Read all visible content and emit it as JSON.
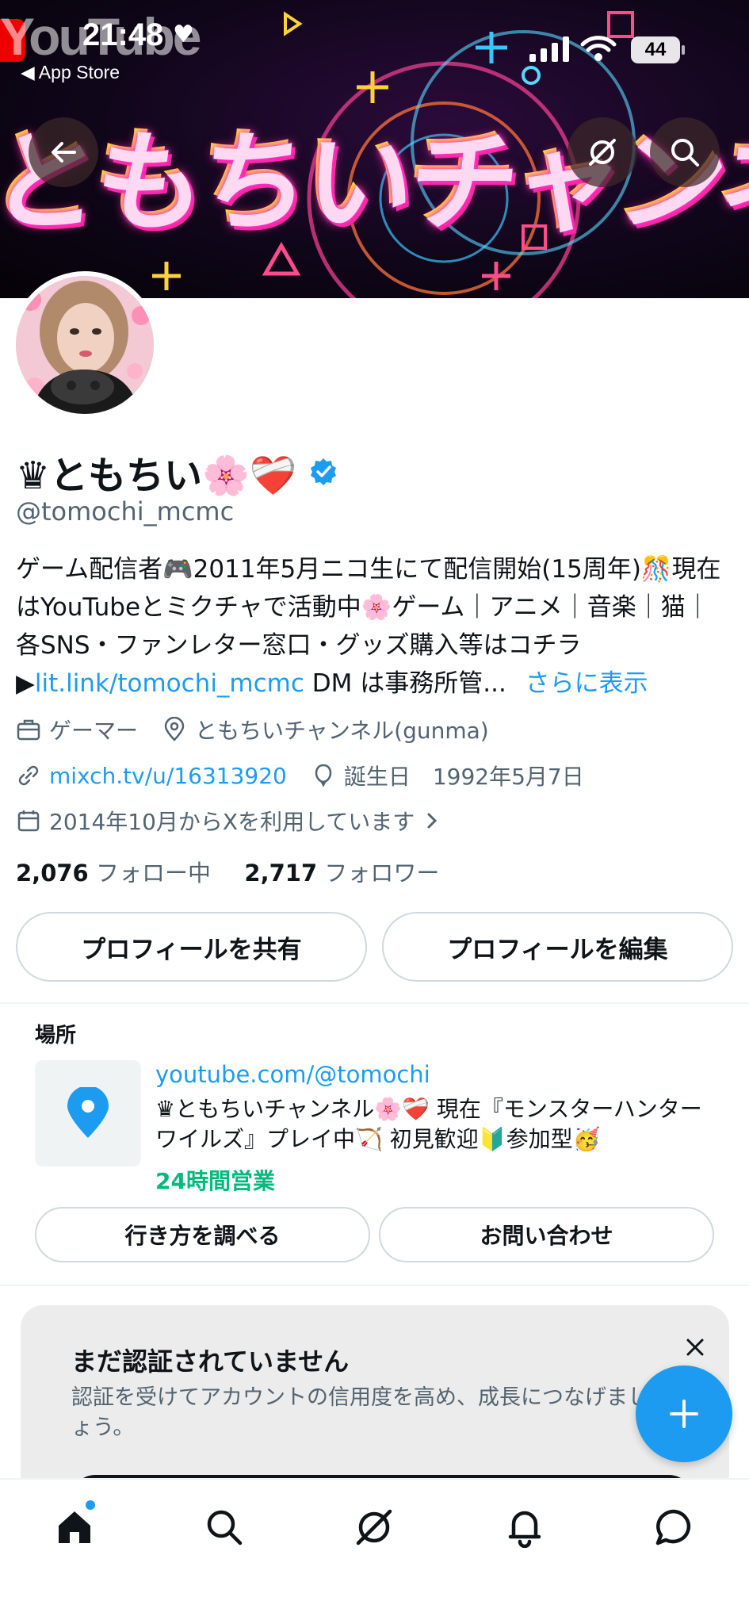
{
  "status_bar": {
    "time": "21:48",
    "back_label": "◀ App Store",
    "battery": "44"
  },
  "banner": {
    "title": "ともちいチャンネル",
    "watermark": "YouTube"
  },
  "profile": {
    "name": "♛ともちい🌸❤️‍🩹",
    "handle": "@tomochi_mcmc",
    "bio_text": "ゲーム配信者🎮2011年5月ニコ生にて配信開始(15周年)🎊現在はYouTubeとミクチャで活動中🌸ゲーム｜アニメ｜音楽｜猫｜ 各SNS・ファンレター窓口・グッズ購入等はコチラ▶",
    "bio_link": "lit.link/tomochi_mcmc",
    "bio_tail": " DM は事務所管...",
    "show_more": "さらに表示",
    "category": "ゲーマー",
    "location": "ともちいチャンネル(gunma)",
    "website": "mixch.tv/u/16313920",
    "birthday": "誕生日　1992年5月7日",
    "joined": "2014年10月からXを利用しています",
    "following_count": "2,076",
    "following_label": "フォロー中",
    "followers_count": "2,717",
    "followers_label": "フォロワー"
  },
  "actions": {
    "share": "プロフィールを共有",
    "edit": "プロフィールを編集"
  },
  "location_card": {
    "heading": "場所",
    "url": "youtube.com/@tomochi",
    "description": "♛ともちいチャンネル🌸❤️‍🩹 現在『モンスターハンター ワイルズ』プレイ中🏹 初見歓迎🔰参加型🥳",
    "hours": "24時間営業",
    "directions": "行き方を調べる",
    "contact": "お問い合わせ"
  },
  "verify_card": {
    "title": "まだ認証されていません",
    "body": "認証を受けてアカウントの信用度を高め、成長につなげましょう。"
  },
  "colors": {
    "accent": "#1d9bf0",
    "open_hours": "#00ba7c",
    "muted": "#536471"
  },
  "icons": [
    "back-arrow-icon",
    "grok-icon",
    "search-icon",
    "verified-badge-icon",
    "briefcase-icon",
    "location-pin-icon",
    "link-icon",
    "balloon-icon",
    "calendar-icon",
    "chevron-right-icon",
    "map-pin-icon",
    "close-icon",
    "plus-icon",
    "home-icon",
    "bell-icon",
    "message-icon"
  ]
}
